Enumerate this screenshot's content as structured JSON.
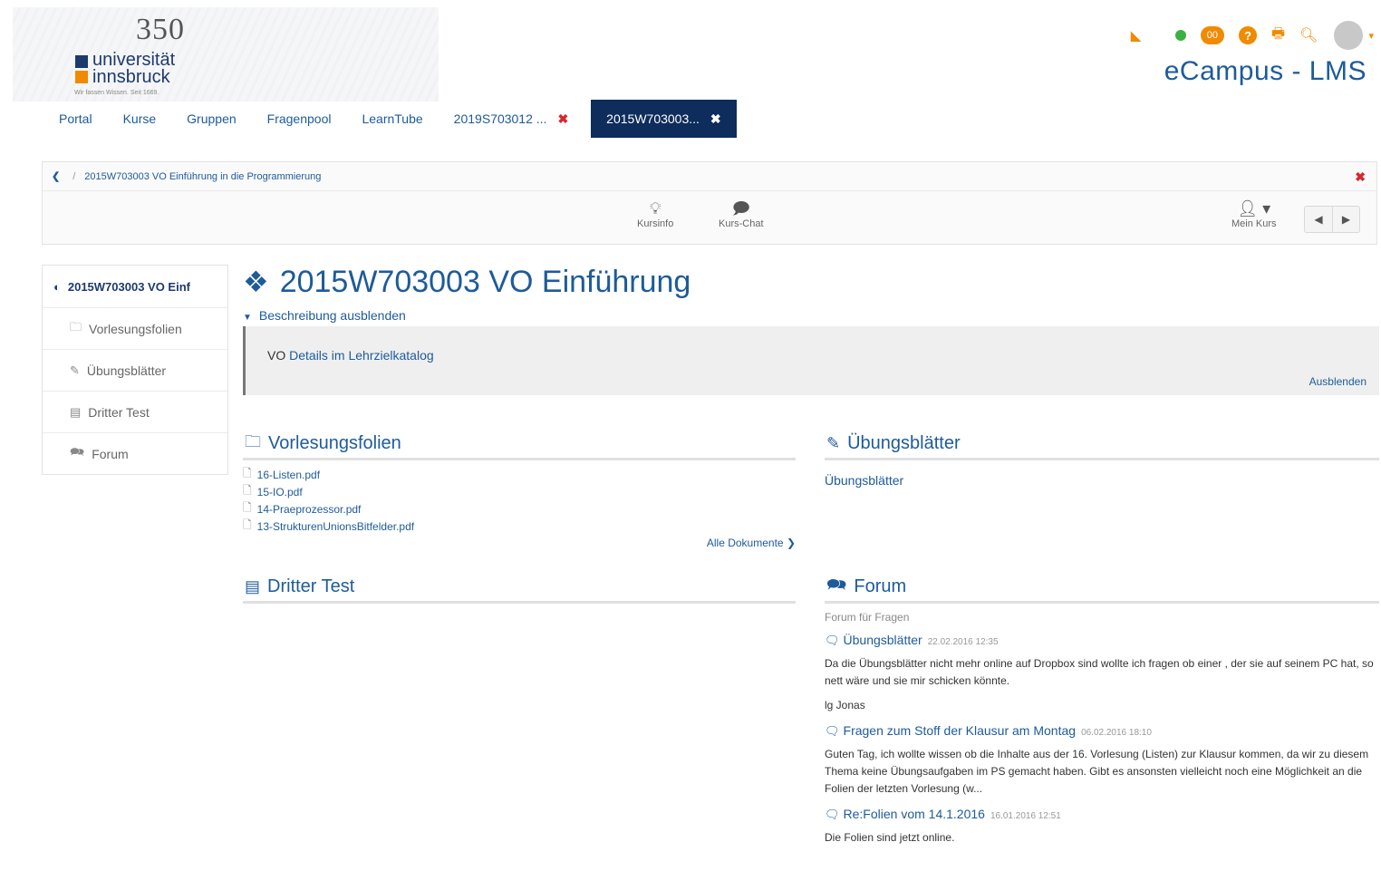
{
  "header": {
    "logo": {
      "anniversary": "350",
      "name_line1": "universität",
      "name_line2": "innsbruck",
      "motto": "Wir fassen Wissen. Seit 1669."
    },
    "brand": "eCampus - LMS",
    "icons": {
      "rss": "rss-icon",
      "online": "online-status-icon",
      "pill_label": "00",
      "help": "?",
      "print": "print-icon",
      "search": "search-icon",
      "avatar": "user-avatar"
    }
  },
  "tabs": [
    {
      "label": "Portal"
    },
    {
      "label": "Kurse"
    },
    {
      "label": "Gruppen"
    },
    {
      "label": "Fragenpool"
    },
    {
      "label": "LearnTube"
    },
    {
      "label": "2019S703012 ..."
    },
    {
      "label": "2015W703003..."
    }
  ],
  "course_bar": {
    "breadcrumb": "2015W703003 VO Einführung in die Programmierung",
    "tools": [
      {
        "label": "Kursinfo"
      },
      {
        "label": "Kurs-Chat"
      },
      {
        "label": "Mein Kurs"
      }
    ]
  },
  "sidebar": {
    "items": [
      {
        "label": "2015W703003 VO Einf"
      },
      {
        "label": "Vorlesungsfolien"
      },
      {
        "label": "Übungsblätter"
      },
      {
        "label": "Dritter Test"
      },
      {
        "label": "Forum"
      }
    ]
  },
  "main": {
    "title": "2015W703003 VO Einführung",
    "description_toggle": "Beschreibung ausblenden",
    "description_prefix": "VO",
    "description_link": "Details im Lehrzielkatalog",
    "description_hide": "Ausblenden"
  },
  "panels": {
    "vorlesungsfolien": {
      "title": "Vorlesungsfolien",
      "docs": [
        "16-Listen.pdf",
        "15-IO.pdf",
        "14-Praeprozessor.pdf",
        "13-StrukturenUnionsBitfelder.pdf"
      ],
      "more": "Alle Dokumente"
    },
    "uebungsblaetter": {
      "title": "Übungsblätter",
      "link": "Übungsblätter"
    },
    "dritter_test": {
      "title": "Dritter Test"
    },
    "forum": {
      "title": "Forum",
      "subtitle": "Forum für Fragen",
      "posts": [
        {
          "title": "Übungsblätter",
          "date": "22.02.2016 12:35",
          "body": [
            "Da die Übungsblätter nicht mehr online auf Dropbox sind wollte ich fragen ob einer , der sie auf seinem PC hat, so nett wäre und sie mir schicken könnte.",
            "lg Jonas"
          ]
        },
        {
          "title": "Fragen zum Stoff der Klausur am Montag",
          "date": "06.02.2016 18:10",
          "body": [
            "Guten Tag, ich wollte wissen ob die Inhalte aus der 16. Vorlesung (Listen) zur Klausur kommen, da wir zu diesem Thema keine Übungsaufgaben im PS gemacht haben. Gibt es ansonsten vielleicht noch eine Möglichkeit an die Folien der letzten Vorlesung (w..."
          ]
        },
        {
          "title": "Re:Folien vom 14.1.2016",
          "date": "16.01.2016 12:51",
          "body": [
            "Die Folien sind jetzt online."
          ]
        }
      ]
    }
  }
}
